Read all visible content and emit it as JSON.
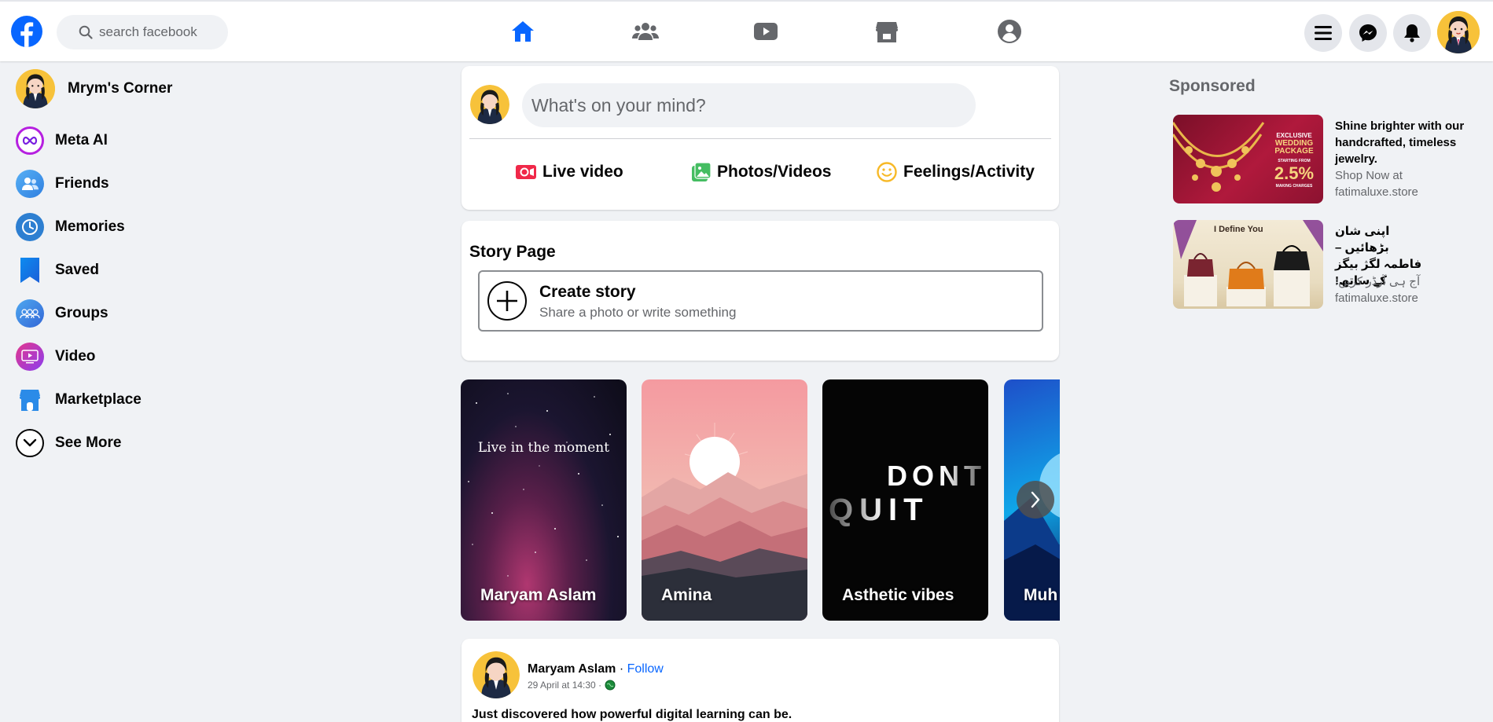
{
  "topbar": {
    "search_placeholder": "search facebook",
    "nav": [
      "home-icon",
      "friends-icon",
      "video-icon",
      "marketplace-icon",
      "profile-icon"
    ],
    "active_nav": "home-icon",
    "accent": "#0866ff"
  },
  "sidebar": {
    "items": [
      {
        "label": "Mrym's Corner",
        "icon": "avatar"
      },
      {
        "label": "Meta AI",
        "icon": "meta-ai-icon"
      },
      {
        "label": "Friends",
        "icon": "friends-icon"
      },
      {
        "label": "Memories",
        "icon": "memories-icon"
      },
      {
        "label": "Saved",
        "icon": "saved-icon"
      },
      {
        "label": "Groups",
        "icon": "groups-icon"
      },
      {
        "label": "Video",
        "icon": "video-icon"
      },
      {
        "label": "Marketplace",
        "icon": "marketplace-icon"
      },
      {
        "label": "See More",
        "icon": "chevron-down-icon"
      }
    ]
  },
  "composer": {
    "placeholder": "What's on your mind?",
    "actions": [
      {
        "label": "Live video",
        "icon": "live-video-icon",
        "color": "#f02849"
      },
      {
        "label": "Photos/Videos",
        "icon": "photo-icon",
        "color": "#45bd62"
      },
      {
        "label": "Feelings/Activity",
        "icon": "feeling-icon",
        "color": "#f7b928"
      }
    ]
  },
  "story_page": {
    "title": "Story Page",
    "create_title": "Create story",
    "create_subtitle": "Share a photo or write something"
  },
  "stories": [
    {
      "name": "Maryam Aslam",
      "text": "Live in the moment"
    },
    {
      "name": "Amina",
      "text": ""
    },
    {
      "name": "Asthetic vibes",
      "text_line1": "DONT",
      "text_line2": "QUIT"
    },
    {
      "name": "Muh"
    }
  ],
  "post": {
    "author": "Maryam Aslam",
    "separator": "·",
    "follow": "Follow",
    "time": "29 April at 14:30 ·",
    "text": "Just discovered how powerful digital learning can be."
  },
  "sponsored": {
    "title": "Sponsored",
    "ads": [
      {
        "headline": "Shine brighter with our handcrafted, timeless jewelry.",
        "cta": "Shop Now at",
        "domain": "fatimaluxe.store",
        "thumb_lines": [
          "EXCLUSIVE",
          "WEDDING",
          "PACKAGE",
          "STARTING FROM",
          "2.5%",
          "MAKING CHARGES"
        ]
      },
      {
        "headline": "اپنی شان بڑھائیں – فاطمہ لگژ بیگز کے ساتھ!",
        "cta": "آج ہی آرڈر کریں:",
        "domain": "fatimaluxe.store",
        "thumb_lines": [
          "I Define You"
        ]
      }
    ]
  }
}
